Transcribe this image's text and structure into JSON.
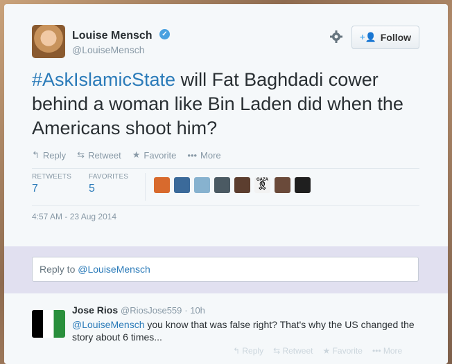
{
  "author": {
    "name": "Louise Mensch",
    "handle": "@LouiseMensch"
  },
  "follow_label": "Follow",
  "tweet": {
    "hashtag": "#AskIslamicState",
    "text": " will Fat Baghdadi cower behind a woman like Bin Laden did when the Americans shoot him?"
  },
  "actions": {
    "reply": "Reply",
    "retweet": "Retweet",
    "favorite": "Favorite",
    "more": "More"
  },
  "stats": {
    "retweets_label": "RETWEETS",
    "retweets_value": "7",
    "favorites_label": "FAVORITES",
    "favorites_value": "5"
  },
  "faces_colors": [
    "#d86a2d",
    "#3b6a9a",
    "#87b2cf",
    "#4b5a63",
    "#5c3e2f",
    "#f2f2f2",
    "#6a4a3a",
    "#1f1f1f"
  ],
  "gaza_ribbon_text": "GAZA",
  "timestamp": "4:57 AM - 23 Aug 2014",
  "reply_box": {
    "prefix": "Reply to ",
    "handle": "@LouiseMensch"
  },
  "reply": {
    "name": "Jose Rios",
    "handle": "@RiosJose559",
    "time": "· 10h",
    "mention": "@LouiseMensch",
    "text": " you know that was false right? That's why the US changed the story about 6 times..."
  },
  "reply_actions": {
    "reply": "Reply",
    "retweet": "Retweet",
    "favorite": "Favorite",
    "more": "More"
  },
  "colors": {
    "link": "#2b7bb9",
    "verified": "#4aa1e0",
    "reply_bar": "#e1e0f0"
  }
}
